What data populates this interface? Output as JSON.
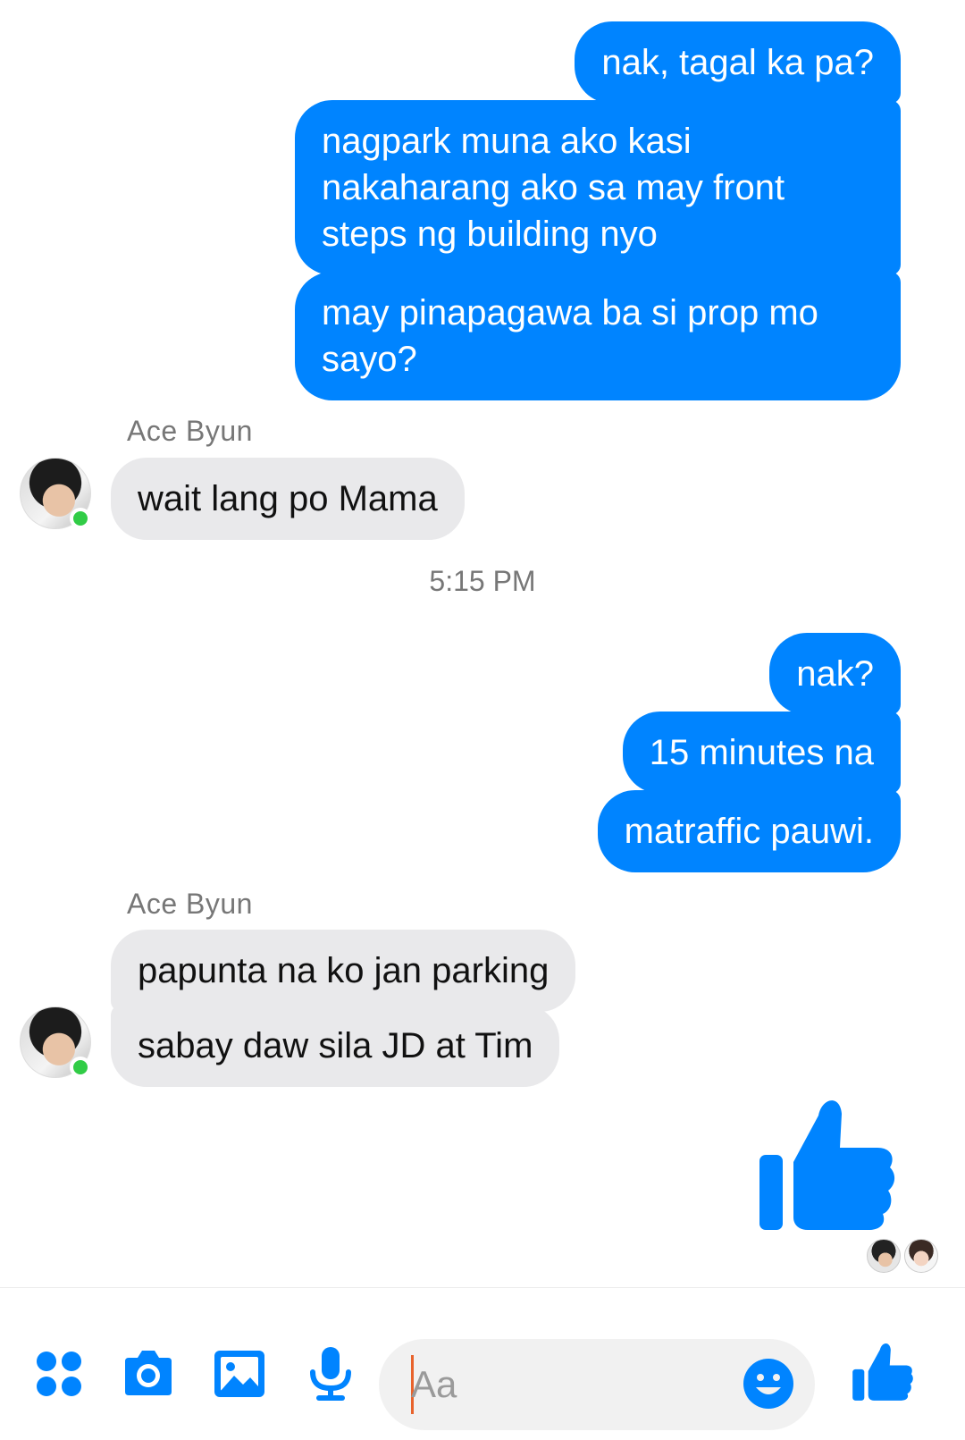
{
  "colors": {
    "outgoing_bubble": "#0084ff",
    "incoming_bubble": "#e9e9eb",
    "accent": "#0084ff",
    "online": "#31cc46"
  },
  "messages": {
    "out_1": "nak, tagal ka pa?",
    "out_2": "nagpark muna ako kasi\nnakaharang ako sa may front\nsteps ng building nyo",
    "out_3": "may pinapagawa ba si prop mo\nsayo?",
    "sender_1": "Ace Byun",
    "in_1": "wait lang po Mama",
    "timestamp": "5:15 PM",
    "out_4": "nak?",
    "out_5": "15 minutes na",
    "out_6": "matraffic pauwi.",
    "sender_2": "Ace Byun",
    "in_2": "papunta na ko jan parking",
    "in_3": "sabay daw sila JD at Tim"
  },
  "composer": {
    "placeholder": "Aa",
    "icons": [
      "apps-icon",
      "camera-icon",
      "gallery-icon",
      "microphone-icon",
      "emoji-icon",
      "like-icon"
    ]
  }
}
